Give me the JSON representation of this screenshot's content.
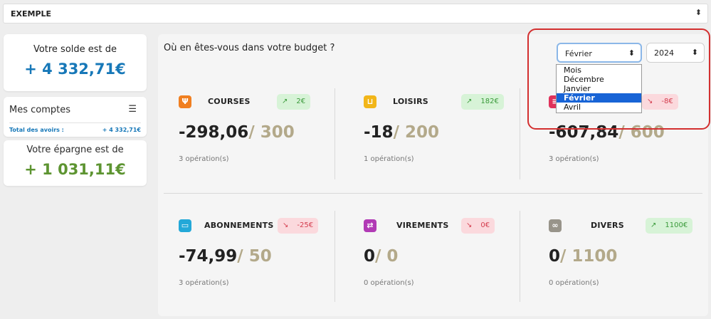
{
  "account_select": {
    "value": "EXEMPLE",
    "arrows": "⬍"
  },
  "solde": {
    "label": "Votre solde est de",
    "amount": "+ 4 332,71€"
  },
  "comptes": {
    "title": "Mes comptes",
    "filter_icon": "☰",
    "total_label": "Total des avoirs :",
    "total_value": "+ 4 332,71€"
  },
  "epargne": {
    "label": "Votre épargne est de",
    "amount": "+ 1 031,11€"
  },
  "budget": {
    "question": "Où en êtes-vous dans votre budget ?",
    "month_select": {
      "value": "Février",
      "arrows": "⬍"
    },
    "year_select": {
      "value": "2024",
      "arrows": "⬍"
    },
    "month_options": [
      "Mois",
      "Décembre",
      "Janvier",
      "Février",
      "Avril"
    ],
    "selected_option": "Février"
  },
  "categories": [
    {
      "name": "COURSES",
      "badge": "2€",
      "trend": "up",
      "trend_glyph": "↗",
      "spent": "-298,06",
      "limit": "/ 300",
      "ops": "3 opération(s)",
      "icon": "utensils-icon",
      "glyph": "Ψ",
      "color": "#f07f20"
    },
    {
      "name": "LOISIRS",
      "badge": "182€",
      "trend": "up",
      "trend_glyph": "↗",
      "spent": "-18",
      "limit": "/ 200",
      "ops": "1 opération(s)",
      "icon": "cart-icon",
      "glyph": "⊔",
      "color": "#f2b619"
    },
    {
      "name": "",
      "badge": "-8€",
      "trend": "down",
      "trend_glyph": "↘",
      "spent": "-607,84",
      "limit": "/ 600",
      "ops": "3 opération(s)",
      "icon": "receipt-icon",
      "glyph": "≡",
      "color": "#e0325b"
    },
    {
      "name": "ABONNEMENTS",
      "badge": "-25€",
      "trend": "down",
      "trend_glyph": "↘",
      "spent": "-74,99",
      "limit": "/ 50",
      "ops": "3 opération(s)",
      "icon": "card-icon",
      "glyph": "▭",
      "color": "#23a8d8"
    },
    {
      "name": "VIREMENTS",
      "badge": "0€",
      "trend": "down",
      "trend_glyph": "↘",
      "spent": "0",
      "limit": "/ 0",
      "ops": "0 opération(s)",
      "icon": "transfer-icon",
      "glyph": "⇄",
      "color": "#b13ab5"
    },
    {
      "name": "DIVERS",
      "badge": "1100€",
      "trend": "up",
      "trend_glyph": "↗",
      "spent": "0",
      "limit": "/ 1100",
      "ops": "0 opération(s)",
      "icon": "misc-icon",
      "glyph": "∞",
      "color": "#98948a"
    }
  ]
}
